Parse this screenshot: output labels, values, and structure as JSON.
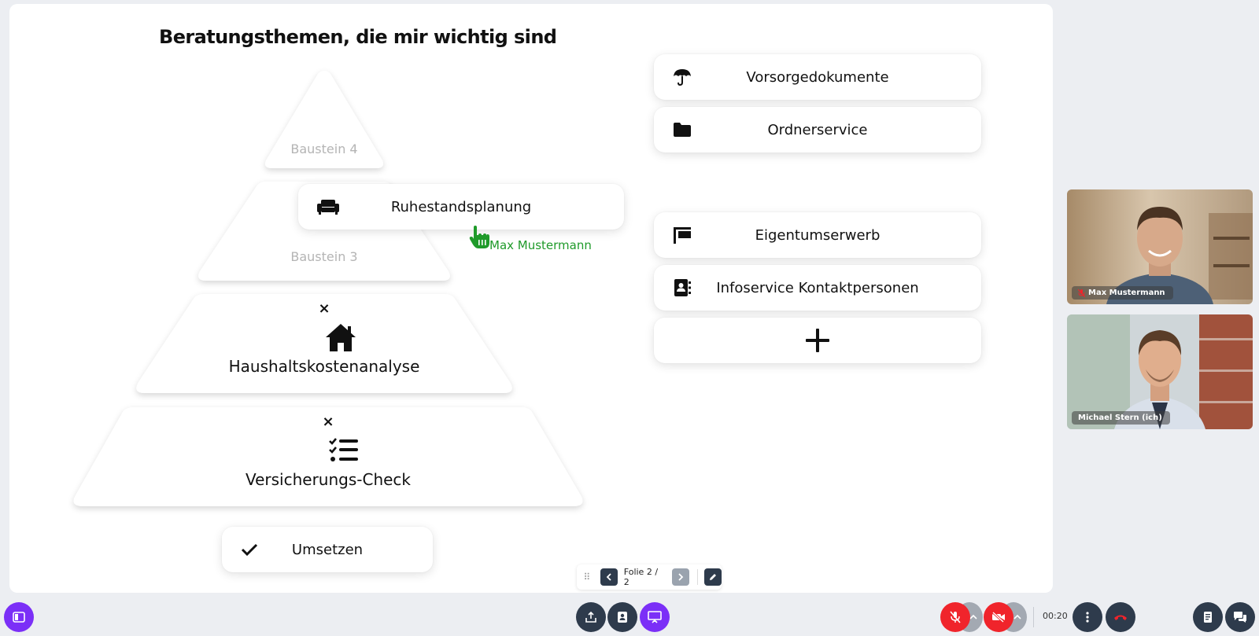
{
  "slide": {
    "title": "Beratungsthemen, die mir wichtig sind",
    "pyramid": {
      "level4_label": "Baustein 4",
      "level3_label": "Baustein 3",
      "level2": {
        "label": "Haushaltskostenanalyse",
        "icon": "house-icon",
        "remove": "×"
      },
      "level1": {
        "label": "Versicherungs-Check",
        "icon": "checklist-icon",
        "remove": "×"
      },
      "base_label": "Umsetzen",
      "base_icon": "check-icon"
    },
    "dragged_card": {
      "label": "Ruhestandsplanung",
      "icon": "sofa-icon"
    },
    "remote_cursor": {
      "name": "Max Mustermann",
      "color": "#1f9a2a"
    },
    "topics": [
      {
        "label": "Vorsorgedokumente",
        "icon": "umbrella-icon"
      },
      {
        "label": "Ordnerservice",
        "icon": "folder-icon"
      },
      {
        "label": "Eigentumserwerb",
        "icon": "flag-sign-icon"
      },
      {
        "label": "Infoservice Kontaktpersonen",
        "icon": "contact-book-icon"
      }
    ],
    "add_topic_icon": "plus-icon"
  },
  "slide_nav": {
    "label": "Folie 2 / 2"
  },
  "participants": [
    {
      "name": "Max Mustermann",
      "muted": true
    },
    {
      "name": "Michael Stern (ich)",
      "muted": false
    }
  ],
  "call": {
    "timer": "00:20"
  },
  "colors": {
    "accent": "#7b2ff7",
    "danger": "#f0242b",
    "dark_button": "#2e3b4c"
  }
}
